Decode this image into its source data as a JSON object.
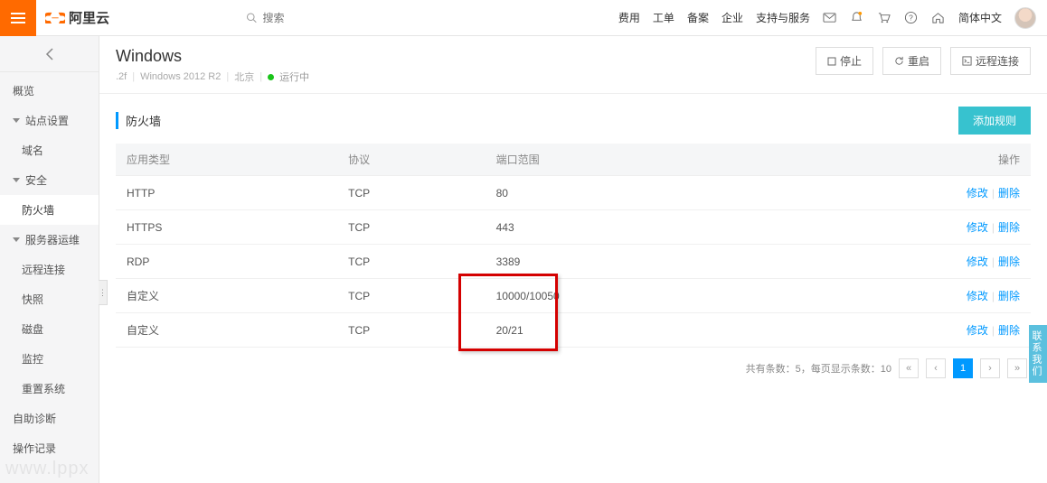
{
  "topnav": {
    "logo_text": "阿里云",
    "search_placeholder": "搜索",
    "links": [
      "费用",
      "工单",
      "备案",
      "企业",
      "支持与服务"
    ],
    "lang": "简体中文"
  },
  "sidebar": {
    "items": [
      {
        "label": "概览",
        "type": "item"
      },
      {
        "label": "站点设置",
        "type": "group"
      },
      {
        "label": "域名",
        "type": "sub"
      },
      {
        "label": "安全",
        "type": "group"
      },
      {
        "label": "防火墙",
        "type": "sub",
        "active": true
      },
      {
        "label": "服务器运维",
        "type": "group"
      },
      {
        "label": "远程连接",
        "type": "sub"
      },
      {
        "label": "快照",
        "type": "sub"
      },
      {
        "label": "磁盘",
        "type": "sub"
      },
      {
        "label": "监控",
        "type": "sub"
      },
      {
        "label": "重置系统",
        "type": "sub"
      },
      {
        "label": "自助诊断",
        "type": "item"
      },
      {
        "label": "操作记录",
        "type": "item"
      }
    ]
  },
  "page": {
    "title": "Windows",
    "sub_id": ".2f",
    "sub_os": "Windows 2012 R2",
    "sub_region": "北京",
    "status": "运行中",
    "btn_stop": "停止",
    "btn_restart": "重启",
    "btn_remote": "远程连接"
  },
  "panel": {
    "title": "防火墙",
    "btn_add": "添加规则"
  },
  "table": {
    "headers": [
      "应用类型",
      "协议",
      "端口范围",
      "操作"
    ],
    "action_edit": "修改",
    "action_delete": "删除",
    "rows": [
      {
        "type": "HTTP",
        "proto": "TCP",
        "port": "80"
      },
      {
        "type": "HTTPS",
        "proto": "TCP",
        "port": "443"
      },
      {
        "type": "RDP",
        "proto": "TCP",
        "port": "3389"
      },
      {
        "type": "自定义",
        "proto": "TCP",
        "port": "10000/10050"
      },
      {
        "type": "自定义",
        "proto": "TCP",
        "port": "20/21"
      }
    ]
  },
  "pager": {
    "text": "共有条数：5，每页显示条数：10",
    "current": "1"
  },
  "feedback": "联系我们",
  "watermark": "www.lppx"
}
